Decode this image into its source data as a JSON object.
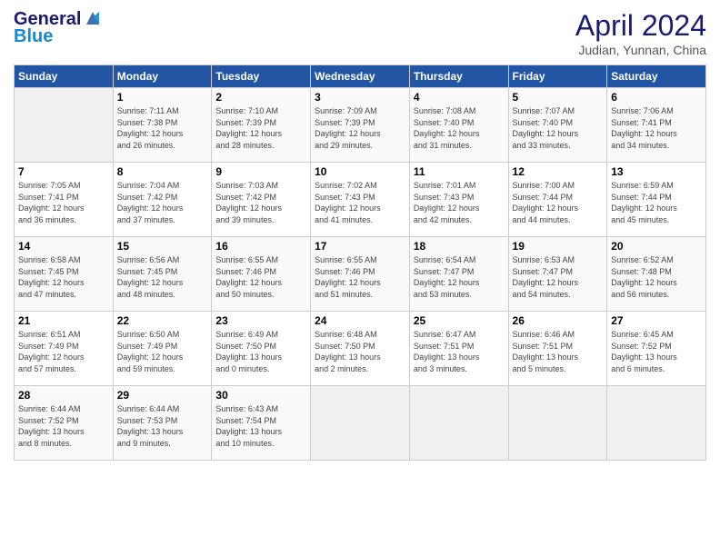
{
  "header": {
    "logo_line1": "General",
    "logo_line2": "Blue",
    "title": "April 2024",
    "subtitle": "Judian, Yunnan, China"
  },
  "days_of_week": [
    "Sunday",
    "Monday",
    "Tuesday",
    "Wednesday",
    "Thursday",
    "Friday",
    "Saturday"
  ],
  "weeks": [
    [
      {
        "day": "",
        "info": ""
      },
      {
        "day": "1",
        "info": "Sunrise: 7:11 AM\nSunset: 7:38 PM\nDaylight: 12 hours\nand 26 minutes."
      },
      {
        "day": "2",
        "info": "Sunrise: 7:10 AM\nSunset: 7:39 PM\nDaylight: 12 hours\nand 28 minutes."
      },
      {
        "day": "3",
        "info": "Sunrise: 7:09 AM\nSunset: 7:39 PM\nDaylight: 12 hours\nand 29 minutes."
      },
      {
        "day": "4",
        "info": "Sunrise: 7:08 AM\nSunset: 7:40 PM\nDaylight: 12 hours\nand 31 minutes."
      },
      {
        "day": "5",
        "info": "Sunrise: 7:07 AM\nSunset: 7:40 PM\nDaylight: 12 hours\nand 33 minutes."
      },
      {
        "day": "6",
        "info": "Sunrise: 7:06 AM\nSunset: 7:41 PM\nDaylight: 12 hours\nand 34 minutes."
      }
    ],
    [
      {
        "day": "7",
        "info": "Sunrise: 7:05 AM\nSunset: 7:41 PM\nDaylight: 12 hours\nand 36 minutes."
      },
      {
        "day": "8",
        "info": "Sunrise: 7:04 AM\nSunset: 7:42 PM\nDaylight: 12 hours\nand 37 minutes."
      },
      {
        "day": "9",
        "info": "Sunrise: 7:03 AM\nSunset: 7:42 PM\nDaylight: 12 hours\nand 39 minutes."
      },
      {
        "day": "10",
        "info": "Sunrise: 7:02 AM\nSunset: 7:43 PM\nDaylight: 12 hours\nand 41 minutes."
      },
      {
        "day": "11",
        "info": "Sunrise: 7:01 AM\nSunset: 7:43 PM\nDaylight: 12 hours\nand 42 minutes."
      },
      {
        "day": "12",
        "info": "Sunrise: 7:00 AM\nSunset: 7:44 PM\nDaylight: 12 hours\nand 44 minutes."
      },
      {
        "day": "13",
        "info": "Sunrise: 6:59 AM\nSunset: 7:44 PM\nDaylight: 12 hours\nand 45 minutes."
      }
    ],
    [
      {
        "day": "14",
        "info": "Sunrise: 6:58 AM\nSunset: 7:45 PM\nDaylight: 12 hours\nand 47 minutes."
      },
      {
        "day": "15",
        "info": "Sunrise: 6:56 AM\nSunset: 7:45 PM\nDaylight: 12 hours\nand 48 minutes."
      },
      {
        "day": "16",
        "info": "Sunrise: 6:55 AM\nSunset: 7:46 PM\nDaylight: 12 hours\nand 50 minutes."
      },
      {
        "day": "17",
        "info": "Sunrise: 6:55 AM\nSunset: 7:46 PM\nDaylight: 12 hours\nand 51 minutes."
      },
      {
        "day": "18",
        "info": "Sunrise: 6:54 AM\nSunset: 7:47 PM\nDaylight: 12 hours\nand 53 minutes."
      },
      {
        "day": "19",
        "info": "Sunrise: 6:53 AM\nSunset: 7:47 PM\nDaylight: 12 hours\nand 54 minutes."
      },
      {
        "day": "20",
        "info": "Sunrise: 6:52 AM\nSunset: 7:48 PM\nDaylight: 12 hours\nand 56 minutes."
      }
    ],
    [
      {
        "day": "21",
        "info": "Sunrise: 6:51 AM\nSunset: 7:49 PM\nDaylight: 12 hours\nand 57 minutes."
      },
      {
        "day": "22",
        "info": "Sunrise: 6:50 AM\nSunset: 7:49 PM\nDaylight: 12 hours\nand 59 minutes."
      },
      {
        "day": "23",
        "info": "Sunrise: 6:49 AM\nSunset: 7:50 PM\nDaylight: 13 hours\nand 0 minutes."
      },
      {
        "day": "24",
        "info": "Sunrise: 6:48 AM\nSunset: 7:50 PM\nDaylight: 13 hours\nand 2 minutes."
      },
      {
        "day": "25",
        "info": "Sunrise: 6:47 AM\nSunset: 7:51 PM\nDaylight: 13 hours\nand 3 minutes."
      },
      {
        "day": "26",
        "info": "Sunrise: 6:46 AM\nSunset: 7:51 PM\nDaylight: 13 hours\nand 5 minutes."
      },
      {
        "day": "27",
        "info": "Sunrise: 6:45 AM\nSunset: 7:52 PM\nDaylight: 13 hours\nand 6 minutes."
      }
    ],
    [
      {
        "day": "28",
        "info": "Sunrise: 6:44 AM\nSunset: 7:52 PM\nDaylight: 13 hours\nand 8 minutes."
      },
      {
        "day": "29",
        "info": "Sunrise: 6:44 AM\nSunset: 7:53 PM\nDaylight: 13 hours\nand 9 minutes."
      },
      {
        "day": "30",
        "info": "Sunrise: 6:43 AM\nSunset: 7:54 PM\nDaylight: 13 hours\nand 10 minutes."
      },
      {
        "day": "",
        "info": ""
      },
      {
        "day": "",
        "info": ""
      },
      {
        "day": "",
        "info": ""
      },
      {
        "day": "",
        "info": ""
      }
    ]
  ]
}
